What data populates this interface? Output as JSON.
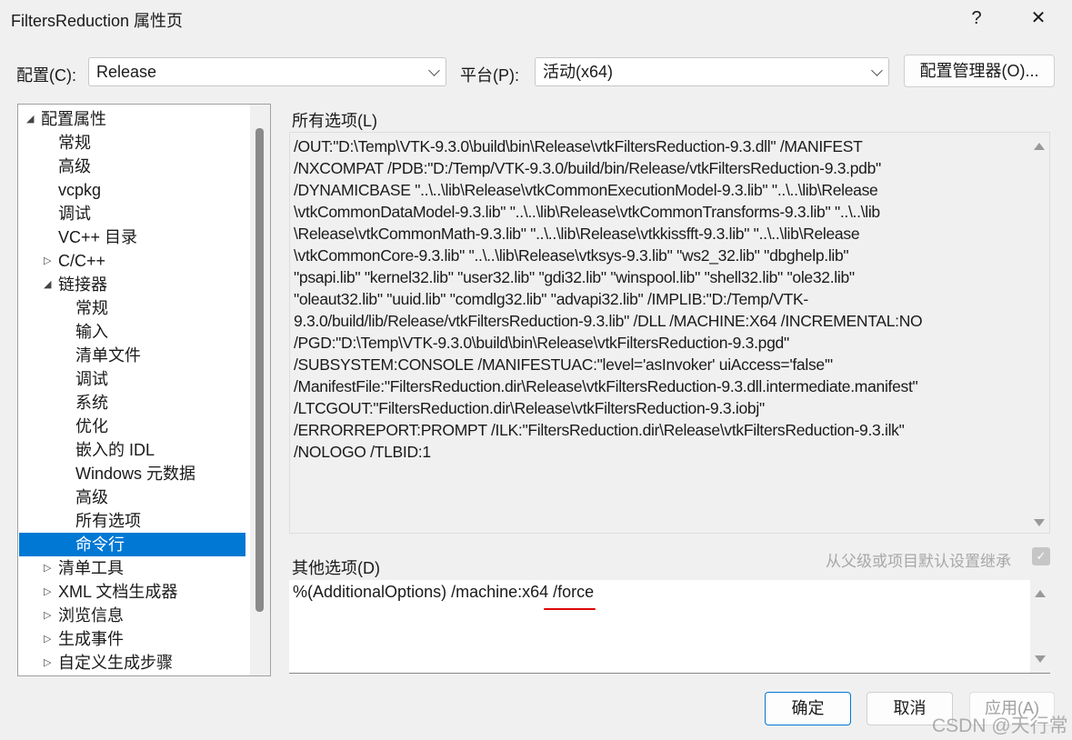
{
  "window": {
    "title": "FiltersReduction 属性页",
    "help": "?",
    "close": "✕"
  },
  "config": {
    "label": "配置(C):",
    "value": "Release"
  },
  "platform": {
    "label": "平台(P):",
    "value": "活动(x64)"
  },
  "config_manager": "配置管理器(O)...",
  "tree": [
    {
      "label": "配置属性",
      "level": 0,
      "expander": "expanded"
    },
    {
      "label": "常规",
      "level": 1
    },
    {
      "label": "高级",
      "level": 1
    },
    {
      "label": "vcpkg",
      "level": 1
    },
    {
      "label": "调试",
      "level": 1
    },
    {
      "label": "VC++ 目录",
      "level": 1
    },
    {
      "label": "C/C++",
      "level": 1,
      "expander": "collapsed"
    },
    {
      "label": "链接器",
      "level": 1,
      "expander": "expanded"
    },
    {
      "label": "常规",
      "level": 2
    },
    {
      "label": "输入",
      "level": 2
    },
    {
      "label": "清单文件",
      "level": 2
    },
    {
      "label": "调试",
      "level": 2
    },
    {
      "label": "系统",
      "level": 2
    },
    {
      "label": "优化",
      "level": 2
    },
    {
      "label": "嵌入的 IDL",
      "level": 2
    },
    {
      "label": "Windows 元数据",
      "level": 2
    },
    {
      "label": "高级",
      "level": 2
    },
    {
      "label": "所有选项",
      "level": 2
    },
    {
      "label": "命令行",
      "level": 2,
      "selected": true
    },
    {
      "label": "清单工具",
      "level": 1,
      "expander": "collapsed"
    },
    {
      "label": "XML 文档生成器",
      "level": 1,
      "expander": "collapsed"
    },
    {
      "label": "浏览信息",
      "level": 1,
      "expander": "collapsed"
    },
    {
      "label": "生成事件",
      "level": 1,
      "expander": "collapsed"
    },
    {
      "label": "自定义生成步骤",
      "level": 1,
      "expander": "collapsed"
    }
  ],
  "all_options": {
    "label": "所有选项(L)",
    "lines": [
      "/OUT:\"D:\\Temp\\VTK-9.3.0\\build\\bin\\Release\\vtkFiltersReduction-9.3.dll\" /MANIFEST",
      "/NXCOMPAT /PDB:\"D:/Temp/VTK-9.3.0/build/bin/Release/vtkFiltersReduction-9.3.pdb\"",
      "/DYNAMICBASE \"..\\..\\lib\\Release\\vtkCommonExecutionModel-9.3.lib\" \"..\\..\\lib\\Release",
      "\\vtkCommonDataModel-9.3.lib\" \"..\\..\\lib\\Release\\vtkCommonTransforms-9.3.lib\" \"..\\..\\lib",
      "\\Release\\vtkCommonMath-9.3.lib\" \"..\\..\\lib\\Release\\vtkkissfft-9.3.lib\" \"..\\..\\lib\\Release",
      "\\vtkCommonCore-9.3.lib\" \"..\\..\\lib\\Release\\vtksys-9.3.lib\" \"ws2_32.lib\" \"dbghelp.lib\"",
      "\"psapi.lib\" \"kernel32.lib\" \"user32.lib\" \"gdi32.lib\" \"winspool.lib\" \"shell32.lib\" \"ole32.lib\"",
      "\"oleaut32.lib\" \"uuid.lib\" \"comdlg32.lib\" \"advapi32.lib\" /IMPLIB:\"D:/Temp/VTK-",
      "9.3.0/build/lib/Release/vtkFiltersReduction-9.3.lib\" /DLL /MACHINE:X64 /INCREMENTAL:NO",
      "/PGD:\"D:\\Temp\\VTK-9.3.0\\build\\bin\\Release\\vtkFiltersReduction-9.3.pgd\"",
      "/SUBSYSTEM:CONSOLE /MANIFESTUAC:\"level='asInvoker' uiAccess='false'\"",
      "/ManifestFile:\"FiltersReduction.dir\\Release\\vtkFiltersReduction-9.3.dll.intermediate.manifest\"",
      "/LTCGOUT:\"FiltersReduction.dir\\Release\\vtkFiltersReduction-9.3.iobj\"",
      "/ERRORREPORT:PROMPT /ILK:\"FiltersReduction.dir\\Release\\vtkFiltersReduction-9.3.ilk\"",
      "/NOLOGO /TLBID:1"
    ]
  },
  "additional": {
    "label": "其他选项(D)",
    "inherit_label": "从父级或项目默认设置继承",
    "inherit_checked": true,
    "value_prefix": "%(AdditionalOptions) /machine:x64 ",
    "value_highlight": "/force",
    "underline_color": "#e00000"
  },
  "buttons": {
    "ok": "确定",
    "cancel": "取消",
    "apply": "应用(A)"
  },
  "watermark": "CSDN @天行常",
  "colors": {
    "accent": "#0078d4"
  }
}
